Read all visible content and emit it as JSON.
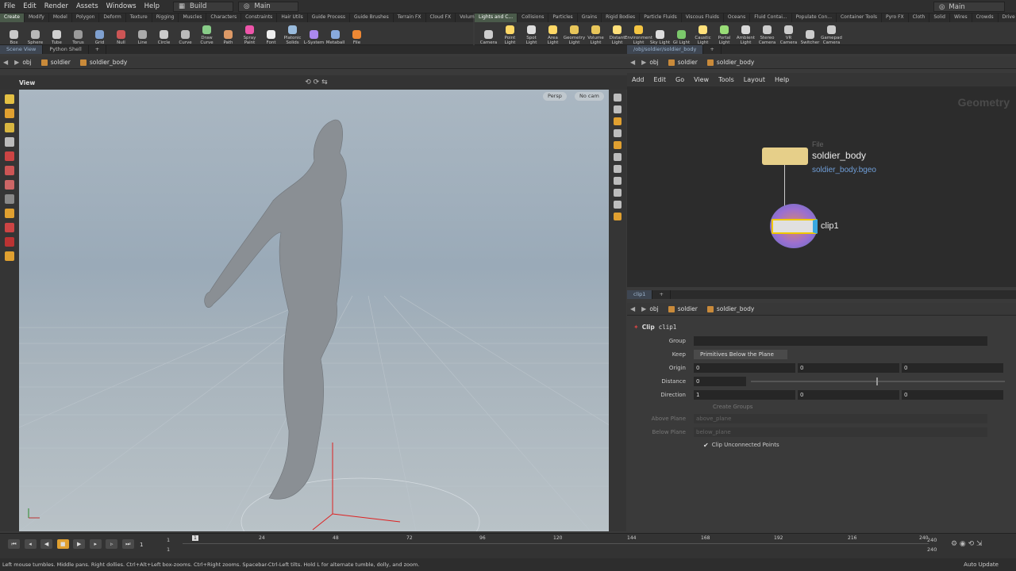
{
  "menubar": {
    "items": [
      "File",
      "Edit",
      "Render",
      "Assets",
      "Windows",
      "Help"
    ],
    "desktop": "Build",
    "context": "Main",
    "right_context": "Main"
  },
  "shelf_left": {
    "tabs": [
      "Create",
      "Modify",
      "Model",
      "Polygon",
      "Deform",
      "Texture",
      "Rigging",
      "Muscles",
      "Characters",
      "Constraints",
      "Hair Utils",
      "Guide Process",
      "Guide Brushes",
      "Terrain FX",
      "Cloud FX",
      "Volume"
    ],
    "tools": [
      "Box",
      "Sphere",
      "Tube",
      "Torus",
      "Grid",
      "Null",
      "Line",
      "Circle",
      "Curve",
      "Draw Curve",
      "Path",
      "Spray Paint",
      "Font",
      "Platonic Solids",
      "L-System",
      "Metaball",
      "File"
    ]
  },
  "shelf_right": {
    "tabs": [
      "Lights and C...",
      "Collisions",
      "Particles",
      "Grains",
      "Rigid Bodies",
      "Particle Fluids",
      "Viscous Fluids",
      "Oceans",
      "Fluid Contai...",
      "Populate Con...",
      "Container Tools",
      "Pyro FX",
      "Cloth",
      "Solid",
      "Wires",
      "Crowds",
      "Drive Simula..."
    ],
    "tools": [
      "Camera",
      "Point Light",
      "Spot Light",
      "Area Light",
      "Geometry Light",
      "Volume Light",
      "Distant Light",
      "Environment Light",
      "Sky Light",
      "GI Light",
      "Caustic Light",
      "Portal Light",
      "Ambient Light",
      "Stereo Camera",
      "VR Camera",
      "Switcher",
      "Gamepad Camera"
    ]
  },
  "left_pane": {
    "tabs": [
      "Scene View",
      "Python Shell"
    ],
    "path": [
      "obj",
      "soldier",
      "soldier_body"
    ],
    "view_label": "View",
    "persp": "Persp",
    "cam": "No cam"
  },
  "net_pane": {
    "tab": "/obj/soldier/soldier_body",
    "path": [
      "obj",
      "soldier",
      "soldier_body"
    ],
    "menu": [
      "Add",
      "Edit",
      "Go",
      "View",
      "Tools",
      "Layout",
      "Help"
    ],
    "context_label": "Geometry",
    "file_node": {
      "type": "File",
      "name": "soldier_body",
      "sub": "soldier_body.bgeo"
    },
    "clip_node": {
      "name": "clip1"
    }
  },
  "param_pane": {
    "tab": "clip1",
    "path": [
      "obj",
      "soldier",
      "soldier_body"
    ],
    "node_type": "Clip",
    "node_name": "clip1",
    "rows": {
      "group": {
        "label": "Group",
        "value": ""
      },
      "keep": {
        "label": "Keep",
        "value": "Primitives Below the Plane"
      },
      "origin": {
        "label": "Origin",
        "values": [
          "0",
          "0",
          "0"
        ]
      },
      "distance": {
        "label": "Distance",
        "value": "0"
      },
      "direction": {
        "label": "Direction",
        "values": [
          "1",
          "0",
          "0"
        ]
      },
      "create_groups": "Create Groups",
      "above": {
        "label": "Above Plane",
        "value": "above_plane"
      },
      "below": {
        "label": "Below Plane",
        "value": "below_plane"
      },
      "clip_unconnected": "Clip Unconnected Points"
    }
  },
  "timeline": {
    "frame": "1",
    "start": "1",
    "start2": "1",
    "ticks": [
      "1",
      "24",
      "48",
      "72",
      "96",
      "120",
      "144",
      "168",
      "192",
      "216",
      "240"
    ],
    "end": "240",
    "end2": "240",
    "auto_update": "Auto Update"
  },
  "status": "Left mouse tumbles. Middle pans. Right dollies. Ctrl+Alt+Left box-zooms. Ctrl+Right zooms. Spacebar-Ctrl-Left tilts. Hold L for alternate tumble, dolly, and zoom."
}
